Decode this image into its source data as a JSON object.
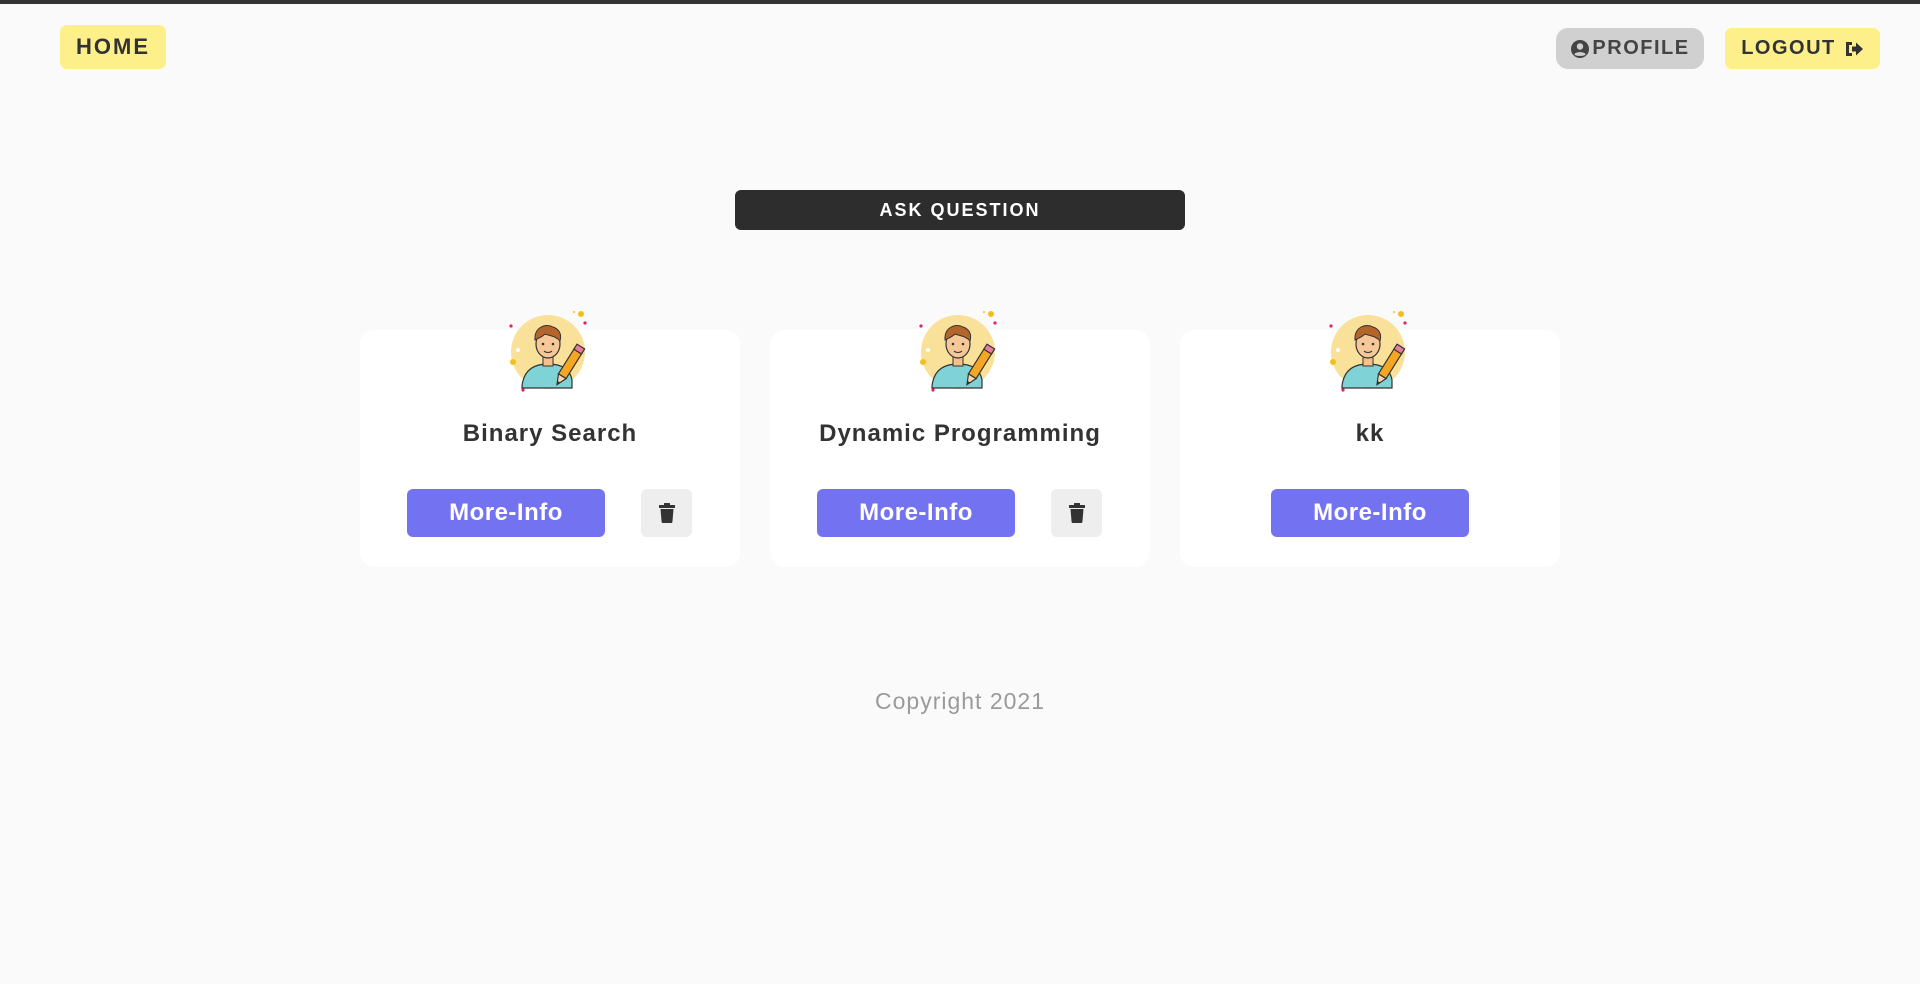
{
  "header": {
    "home_label": "HOME",
    "profile_label": "PROFILE",
    "logout_label": "LOGOUT"
  },
  "ask_button_label": "ASK QUESTION",
  "cards": [
    {
      "title": "Binary Search",
      "more_label": "More-Info",
      "has_delete": true
    },
    {
      "title": "Dynamic Programming",
      "more_label": "More-Info",
      "has_delete": true
    },
    {
      "title": "kk",
      "more_label": "More-Info",
      "has_delete": false
    }
  ],
  "icons": {
    "profile": "user-circle-icon",
    "logout": "sign-out-icon",
    "delete": "trash-icon",
    "avatar": "writer-avatar-icon"
  },
  "colors": {
    "accent_yellow": "#fdf08a",
    "primary_purple": "#7373f2",
    "dark": "#2d2d2d",
    "profile_gray": "#d0d0d0"
  },
  "footer": {
    "copyright": "Copyright 2021"
  }
}
